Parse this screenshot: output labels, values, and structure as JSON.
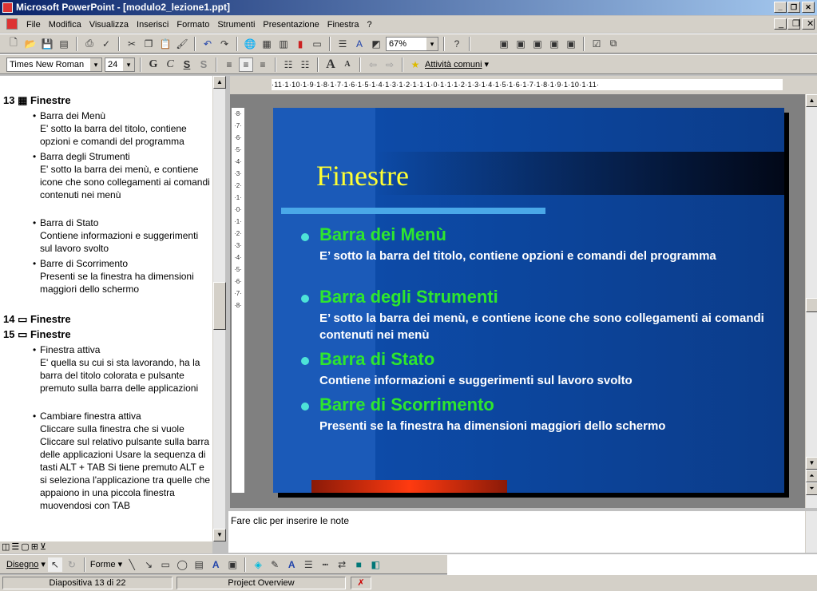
{
  "window": {
    "title": "Microsoft PowerPoint - [modulo2_lezione1.ppt]"
  },
  "menu": [
    "File",
    "Modifica",
    "Visualizza",
    "Inserisci",
    "Formato",
    "Strumenti",
    "Presentazione",
    "Finestra",
    "?"
  ],
  "toolbar": {
    "zoom": "67%",
    "font": "Times New Roman",
    "size": "24",
    "bold": "G",
    "italic": "C",
    "underline": "S",
    "shadow": "S",
    "common_tasks": "Attività comuni"
  },
  "outline": {
    "s13": {
      "num": "13",
      "title": "Finestre",
      "items": [
        {
          "h": "Barra dei Menù",
          "t": "E' sotto la barra del titolo, contiene opzioni e comandi del programma"
        },
        {
          "h": "Barra degli Strumenti",
          "t": "E' sotto la barra dei menù, e contiene icone che sono collegamenti ai comandi contenuti nei menù"
        },
        {
          "h": "Barra di Stato",
          "t": "Contiene informazioni e suggerimenti sul lavoro svolto"
        },
        {
          "h": "Barre di Scorrimento",
          "t": "Presenti se la finestra ha dimensioni maggiori dello schermo"
        }
      ]
    },
    "s14": {
      "num": "14",
      "title": "Finestre"
    },
    "s15": {
      "num": "15",
      "title": "Finestre",
      "items": [
        {
          "h": "Finestra attiva",
          "t": "E' quella su cui si sta lavorando, ha la barra del titolo colorata e pulsante premuto sulla barra delle applicazioni"
        },
        {
          "h": "Cambiare finestra attiva",
          "t": "Cliccare sulla finestra che si vuole Cliccare sul relativo pulsante sulla barra delle applicazioni Usare la sequenza di tasti ALT + TAB Si tiene premuto ALT e si seleziona l'applicazione tra quelle che appaiono in una piccola finestra muovendosi con TAB"
        }
      ]
    }
  },
  "ruler": "·11·1·10·1·9·1·8·1·7·1·6·1·5·1·4·1·3·1·2·1·1·1·0·1·1·1·2·1·3·1·4·1·5·1·6·1·7·1·8·1·9·1·10·1·11·",
  "slide": {
    "title": "Finestre",
    "bullets": [
      {
        "h": "Barra dei Menù",
        "t": "E’ sotto la barra del titolo, contiene opzioni e comandi del programma"
      },
      {
        "h": "Barra degli Strumenti",
        "t": "E’ sotto la barra dei menù, e contiene icone che sono collegamenti ai comandi contenuti nei menù"
      },
      {
        "h": "Barra di Stato",
        "t": "Contiene informazioni e suggerimenti sul lavoro svolto"
      },
      {
        "h": "Barre di Scorrimento",
        "t": "Presenti se la finestra ha dimensioni maggiori dello schermo"
      }
    ],
    "colors": {
      "title": "#ffff33",
      "heading": "#2ee62e",
      "text": "#ffffff",
      "background": "#0d4ba8"
    }
  },
  "notes": {
    "placeholder": "Fare clic per inserire le note"
  },
  "drawing": {
    "draw": "Disegno",
    "shapes": "Forme"
  },
  "status": {
    "slide": "Diapositiva 13 di 22",
    "design": "Project Overview"
  }
}
